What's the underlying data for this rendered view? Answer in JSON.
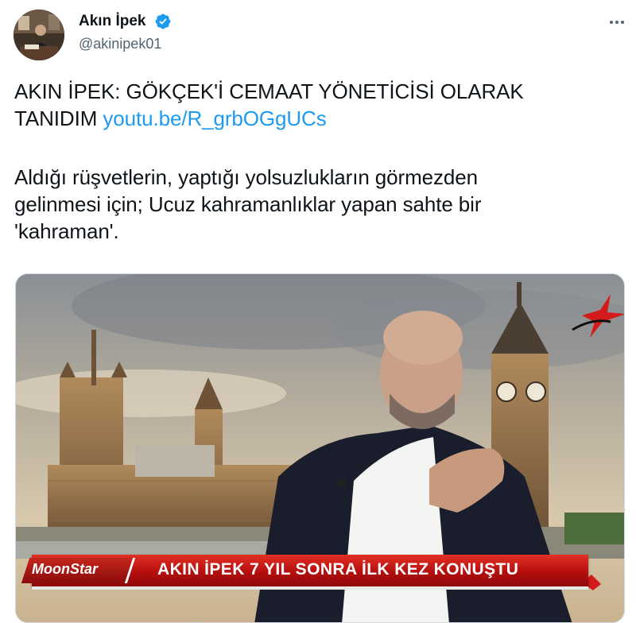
{
  "author": {
    "name": "Akın İpek",
    "handle": "@akinipek01"
  },
  "tweet": {
    "text_line1": "AKIN İPEK: GÖKÇEK'İ CEMAAT YÖNETİCİSİ OLARAK",
    "text_line2": "TANIDIM",
    "link": "youtu.be/R_grbOGgUCs",
    "body_line1": "Aldığı rüşvetlerin, yaptığı yolsuzlukların görmezden",
    "body_line2": "gelinmesi için; Ucuz kahramanlıklar yapan sahte bir",
    "body_line3": "'kahraman'."
  },
  "media": {
    "channel_logo": "MoonStar",
    "headline": "AKIN İPEK 7 YIL SONRA İLK KEZ KONUŞTU"
  },
  "icons": {
    "verified": "verified-badge-icon",
    "more": "more-options-icon",
    "channel": "channel-star-logo"
  },
  "colors": {
    "link": "#1d9bf0",
    "verified": "#1d9bf0",
    "secondary_text": "#536471",
    "banner_red": "#c0161a"
  }
}
